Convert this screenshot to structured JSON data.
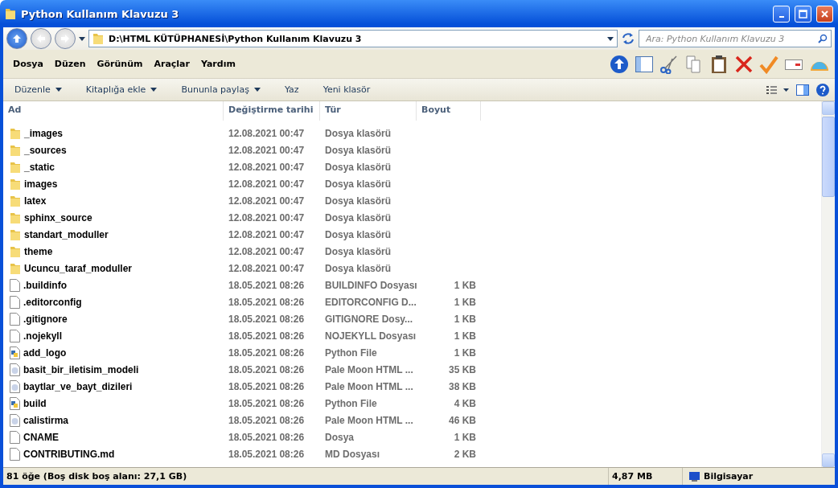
{
  "window": {
    "title": "Python Kullanım Klavuzu 3"
  },
  "address": {
    "path": "D:\\HTML KÜTÜPHANESİ\\Python Kullanım Klavuzu 3"
  },
  "search": {
    "placeholder": "Ara: Python Kullanım Klavuzu 3"
  },
  "menu": [
    "Dosya",
    "Düzen",
    "Görünüm",
    "Araçlar",
    "Yardım"
  ],
  "commands": [
    {
      "label": "Düzenle",
      "dropdown": true
    },
    {
      "label": "Kitaplığa ekle",
      "dropdown": true
    },
    {
      "label": "Bununla paylaş",
      "dropdown": true
    },
    {
      "label": "Yaz",
      "dropdown": false
    },
    {
      "label": "Yeni klasör",
      "dropdown": false
    }
  ],
  "table": {
    "columns": [
      "Ad",
      "Değiştirme tarihi",
      "Tür",
      "Boyut"
    ],
    "rows": [
      {
        "kind": "folder",
        "name": "_images",
        "date": "12.08.2021 00:47",
        "type": "Dosya klasörü"
      },
      {
        "kind": "folder",
        "name": "_sources",
        "date": "12.08.2021 00:47",
        "type": "Dosya klasörü"
      },
      {
        "kind": "folder",
        "name": "_static",
        "date": "12.08.2021 00:47",
        "type": "Dosya klasörü"
      },
      {
        "kind": "folder",
        "name": "images",
        "date": "12.08.2021 00:47",
        "type": "Dosya klasörü"
      },
      {
        "kind": "folder",
        "name": "latex",
        "date": "12.08.2021 00:47",
        "type": "Dosya klasörü"
      },
      {
        "kind": "folder",
        "name": "sphinx_source",
        "date": "12.08.2021 00:47",
        "type": "Dosya klasörü"
      },
      {
        "kind": "folder",
        "name": "standart_moduller",
        "date": "12.08.2021 00:47",
        "type": "Dosya klasörü"
      },
      {
        "kind": "folder",
        "name": "theme",
        "date": "12.08.2021 00:47",
        "type": "Dosya klasörü"
      },
      {
        "kind": "folder",
        "name": "Ucuncu_taraf_moduller",
        "date": "12.08.2021 00:47",
        "type": "Dosya klasörü"
      },
      {
        "kind": "file",
        "name": ".buildinfo",
        "date": "18.05.2021 08:26",
        "type": "BUILDINFO Dosyası",
        "size": "1 KB"
      },
      {
        "kind": "file",
        "name": ".editorconfig",
        "date": "18.05.2021 08:26",
        "type": "EDITORCONFIG D...",
        "size": "1 KB"
      },
      {
        "kind": "file",
        "name": ".gitignore",
        "date": "18.05.2021 08:26",
        "type": "GITIGNORE Dosy...",
        "size": "1 KB"
      },
      {
        "kind": "file",
        "name": ".nojekyll",
        "date": "18.05.2021 08:26",
        "type": "NOJEKYLL Dosyası",
        "size": "1 KB"
      },
      {
        "kind": "python",
        "name": "add_logo",
        "date": "18.05.2021 08:26",
        "type": "Python File",
        "size": "1 KB"
      },
      {
        "kind": "html",
        "name": "basit_bir_iletisim_modeli",
        "date": "18.05.2021 08:26",
        "type": "Pale Moon HTML ...",
        "size": "35 KB"
      },
      {
        "kind": "html",
        "name": "baytlar_ve_bayt_dizileri",
        "date": "18.05.2021 08:26",
        "type": "Pale Moon HTML ...",
        "size": "38 KB"
      },
      {
        "kind": "python",
        "name": "build",
        "date": "18.05.2021 08:26",
        "type": "Python File",
        "size": "4 KB"
      },
      {
        "kind": "html",
        "name": "calistirma",
        "date": "18.05.2021 08:26",
        "type": "Pale Moon HTML ...",
        "size": "46 KB"
      },
      {
        "kind": "file",
        "name": "CNAME",
        "date": "18.05.2021 08:26",
        "type": "Dosya",
        "size": "1 KB"
      },
      {
        "kind": "file",
        "name": "CONTRIBUTING.md",
        "date": "18.05.2021 08:26",
        "type": "MD Dosyası",
        "size": "2 KB"
      }
    ]
  },
  "status_bar": {
    "items_count": "81 öğe (Boş disk boş alanı: 27,1 GB)",
    "size": "4,87 MB",
    "location": "Bilgisayar"
  }
}
